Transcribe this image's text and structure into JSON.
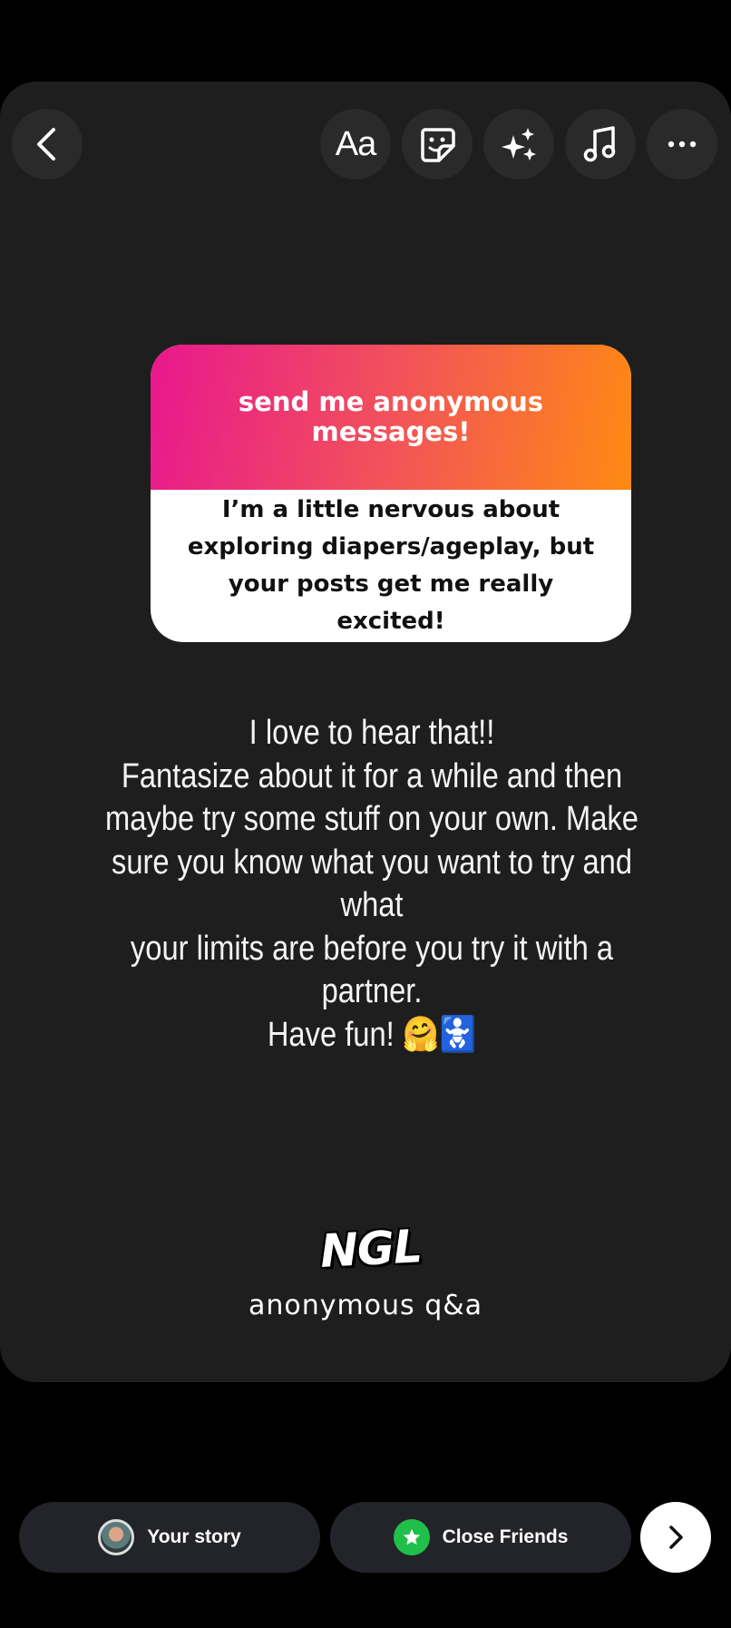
{
  "toolbar": {
    "back_icon": "chevron-left-icon",
    "text_tool_label": "Aa",
    "sticker_icon": "sticker-icon",
    "effects_icon": "sparkles-icon",
    "music_icon": "music-note-icon",
    "more_icon": "more-horizontal-icon"
  },
  "qa_card": {
    "header": "send me anonymous messages!",
    "question": "I’m a little nervous about exploring diapers/ageplay, but your posts get me really excited!",
    "gradient_start": "#e8178e",
    "gradient_mid": "#f2525a",
    "gradient_end": "#ff8a12"
  },
  "reply_text": "I love to hear that!!\nFantasize about it for a while and then\nmaybe try some stuff on your own. Make\nsure you know what you want to try and what\nyour limits are before you try it with a\npartner.\nHave fun! 🤗🚼",
  "branding": {
    "logo": "NGL",
    "caption": "anonymous q&a"
  },
  "share": {
    "your_story_label": "Your story",
    "close_friends_label": "Close Friends",
    "close_friends_color": "#1fbf4a",
    "next_icon": "chevron-right-icon"
  },
  "colors": {
    "background": "#000000",
    "canvas": "#1e1e1e",
    "button": "#2a2a2a"
  }
}
